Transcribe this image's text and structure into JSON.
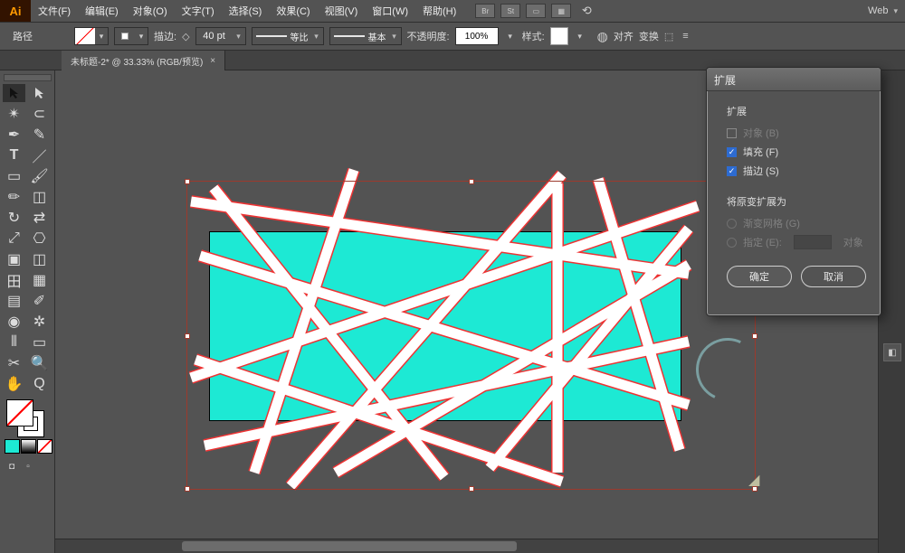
{
  "app": {
    "logo_text": "Ai"
  },
  "menu": {
    "items": [
      "文件(F)",
      "编辑(E)",
      "对象(O)",
      "文字(T)",
      "选择(S)",
      "效果(C)",
      "视图(V)",
      "窗口(W)",
      "帮助(H)"
    ],
    "right_icons": [
      "Br",
      "St",
      "▭",
      "▦"
    ],
    "workspace": "Web",
    "workspace_caret": "▾"
  },
  "control": {
    "left_label": "路径",
    "stroke_label": "描边:",
    "stroke_arrow": "◇",
    "stroke_value": "40 pt",
    "profile1_tag": "等比",
    "profile2_tag": "基本",
    "opacity_label": "不透明度:",
    "opacity_value": "100%",
    "style_label": "样式:",
    "globe": "◍",
    "align_label": "对齐",
    "transform_label": "变换",
    "more": "≡"
  },
  "tab": {
    "title": "未标题-2* @ 33.33% (RGB/预览)",
    "close": "×"
  },
  "dialog": {
    "title": "扩展",
    "section1": "扩展",
    "opt_object": "对象 (B)",
    "opt_fill": "填充 (F)",
    "opt_stroke": "描边 (S)",
    "section2": "将原变扩展为",
    "opt_gradmesh": "渐变网格 (G)",
    "opt_specify": "指定 (E):",
    "specify_val": "",
    "specify_suffix": "对象",
    "ok": "确定",
    "cancel": "取消"
  },
  "colors": {
    "teal": "#1de9d4"
  }
}
